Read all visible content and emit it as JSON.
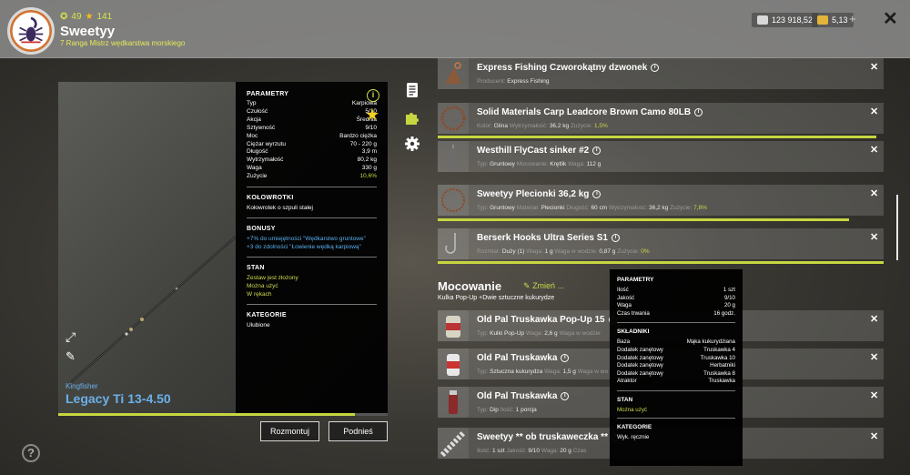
{
  "player": {
    "level": "49",
    "stars": "141",
    "name": "Sweetyy",
    "rank": "7 Ranga Mistrz wędkarstwa morskiego"
  },
  "currency": {
    "money": "123 918,52",
    "gold": "5,13"
  },
  "rod": {
    "brand": "Kingfisher",
    "name": "Legacy Ti 13-4.50",
    "progress": 0.9
  },
  "stats": {
    "params_title": "PARAMETRY",
    "params": [
      {
        "label": "Typ",
        "value": "Karpiowa"
      },
      {
        "label": "Czułość",
        "value": "5/10"
      },
      {
        "label": "Akcja",
        "value": "Średnia"
      },
      {
        "label": "Sztywność",
        "value": "9/10"
      },
      {
        "label": "Moc",
        "value": "Bardzo ciężka"
      },
      {
        "label": "Ciężar wyrzutu",
        "value": "70 - 220 g"
      },
      {
        "label": "Długość",
        "value": "3,9 m"
      },
      {
        "label": "Wytrzymałość",
        "value": "80,2 kg"
      },
      {
        "label": "Waga",
        "value": "330 g"
      },
      {
        "label": "Zużycie",
        "value": "10,6%"
      }
    ],
    "reels_title": "KOŁOWROTKI",
    "reels_text": "Kołowrotek o szpuli stałej",
    "bonus_title": "BONUSY",
    "bonus_1": "+7% do umiejętności \"Wędkarstwo gruntowe\"",
    "bonus_2": "+3 do zdolności \"Łowienie wędką karpiową\"",
    "state_title": "STAN",
    "state_1": "Zestaw jest złożony",
    "state_2": "Można użyć",
    "state_3": "W rękach",
    "cat_title": "KATEGORIE",
    "cat_value": "Ulubione"
  },
  "buttons": {
    "disassemble": "Rozmontuj",
    "lift": "Podnieś"
  },
  "items": [
    {
      "name": "Express Fishing Czworokątny dzwonek",
      "sub": [
        {
          "k": "Producent:",
          "v": "Express Fishing"
        }
      ]
    },
    {
      "name": "Solid Materials Carp Leadcore Brown Camo 80LB",
      "sub": [
        {
          "k": "Kolor:",
          "v": "Glina"
        },
        {
          "k": "Wytrzymałość:",
          "v": "36,2 kg"
        },
        {
          "k": "Zużycie:",
          "v": "1,5%",
          "g": true
        }
      ]
    },
    {
      "name": "Westhill FlyCast sinker #2",
      "sub": [
        {
          "k": "Typ:",
          "v": "Gruntowy"
        },
        {
          "k": "Mocowanie:",
          "v": "Krętlik"
        },
        {
          "k": "Waga:",
          "v": "112 g"
        }
      ]
    },
    {
      "name": "Sweetyy Plecionki 36,2 kg",
      "sub": [
        {
          "k": "Typ:",
          "v": "Gruntowy"
        },
        {
          "k": "Materiał:",
          "v": "Plecionki"
        },
        {
          "k": "Długość:",
          "v": "60 cm"
        },
        {
          "k": "Wytrzymałość:",
          "v": "36,2 kg"
        },
        {
          "k": "Zużycie:",
          "v": "7,8%",
          "g": true
        }
      ]
    },
    {
      "name": "Berserk Hooks Ultra Series S1",
      "sub": [
        {
          "k": "Rozmiar:",
          "v": "Duży (1)"
        },
        {
          "k": "Waga:",
          "v": "1 g"
        },
        {
          "k": "Waga w wodzie:",
          "v": "0,87 g"
        },
        {
          "k": "Zużycie:",
          "v": "0%",
          "g": true
        }
      ]
    }
  ],
  "mocowanie": {
    "title": "Mocowanie",
    "change": "Zmień ...",
    "subtitle": "Kulka Pop-Up +Dwie sztuczne kukurydze"
  },
  "baits": [
    {
      "name": "Old Pal Truskawka Pop-Up 15",
      "sub": [
        {
          "k": "Typ:",
          "v": "Kulki Pop-Up"
        },
        {
          "k": "Waga:",
          "v": "2,6 g"
        },
        {
          "k": "Waga w wodzie",
          "v": ""
        }
      ]
    },
    {
      "name": "Old Pal Truskawka",
      "sub": [
        {
          "k": "Typ:",
          "v": "Sztuczna kukurydza"
        },
        {
          "k": "Waga:",
          "v": "1,5 g"
        },
        {
          "k": "Waga w wo",
          "v": ""
        }
      ]
    },
    {
      "name": "Old Pal Truskawka",
      "sub": [
        {
          "k": "Typ:",
          "v": "Dip"
        },
        {
          "k": "Ilość:",
          "v": "1 porcja"
        }
      ]
    },
    {
      "name": "Sweetyy ** ob truskaweczka **",
      "sub": [
        {
          "k": "Ilość:",
          "v": "1 szt"
        },
        {
          "k": "Jakość:",
          "v": "9/10"
        },
        {
          "k": "Waga:",
          "v": "20 g"
        },
        {
          "k": "Czas",
          "v": ""
        }
      ]
    }
  ],
  "tooltip": {
    "params_title": "PARAMETRY",
    "params": [
      {
        "label": "Ilość",
        "value": "1 szt"
      },
      {
        "label": "Jakość",
        "value": "9/10"
      },
      {
        "label": "Waga",
        "value": "20 g"
      },
      {
        "label": "Czas trwania",
        "value": "16 godz."
      }
    ],
    "ingr_title": "SKŁADNIKI",
    "ingredients": [
      {
        "label": "Baza",
        "value": "Mąka kukurydziana"
      },
      {
        "label": "Dodatek zanętowy",
        "value": "Truskawka 4"
      },
      {
        "label": "Dodatek zanętowy",
        "value": "Truskawka 10"
      },
      {
        "label": "Dodatek zanętowy",
        "value": "Herbatniki"
      },
      {
        "label": "Dodatek zanętowy",
        "value": "Truskawka 8"
      },
      {
        "label": "Atraktor",
        "value": "Truskawka"
      }
    ],
    "state_title": "STAN",
    "state": "Można użyć",
    "cat_title": "KATEGORIE",
    "cat": "Wyk. ręcznie"
  },
  "colors": {
    "accent": "#c6d640",
    "link_blue": "#5ab0ee"
  }
}
